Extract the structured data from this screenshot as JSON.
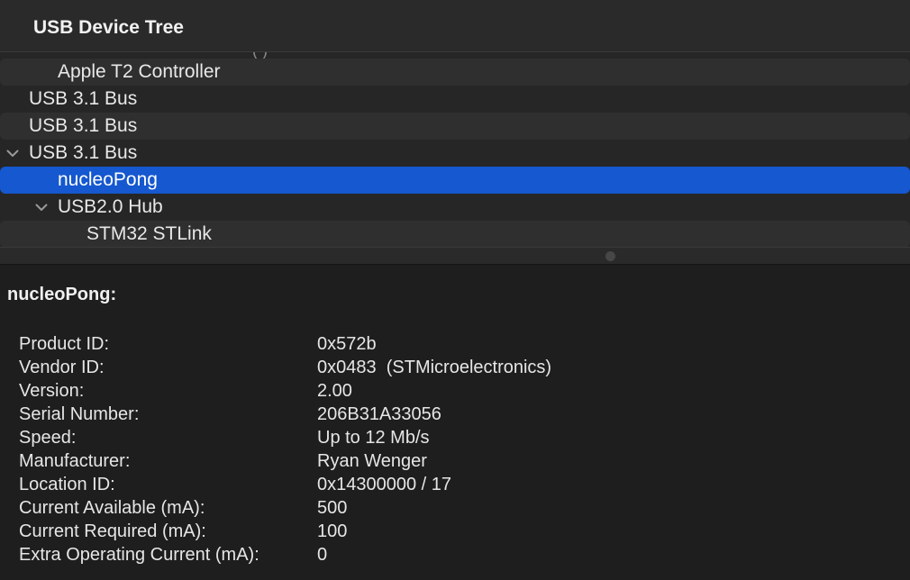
{
  "tree": {
    "header_title": "USB Device Tree",
    "cut_text": "( )",
    "rows": [
      {
        "label": "Apple T2 Controller",
        "level": 2,
        "expanded": null,
        "selected": false
      },
      {
        "label": "USB 3.1 Bus",
        "level": 1,
        "expanded": false,
        "selected": false
      },
      {
        "label": "USB 3.1 Bus",
        "level": 1,
        "expanded": false,
        "selected": false
      },
      {
        "label": "USB 3.1 Bus",
        "level": 1,
        "expanded": true,
        "selected": false
      },
      {
        "label": "nucleoPong",
        "level": 2,
        "expanded": null,
        "selected": true
      },
      {
        "label": "USB2.0 Hub",
        "level": 2,
        "expanded": true,
        "selected": false
      },
      {
        "label": "STM32 STLink",
        "level": 3,
        "expanded": null,
        "selected": false
      }
    ]
  },
  "detail": {
    "title": "nucleoPong:",
    "properties": [
      {
        "key": "Product ID:",
        "value": "0x572b"
      },
      {
        "key": "Vendor ID:",
        "value": "0x0483  (STMicroelectronics)"
      },
      {
        "key": "Version:",
        "value": "2.00"
      },
      {
        "key": "Serial Number:",
        "value": "206B31A33056"
      },
      {
        "key": "Speed:",
        "value": "Up to 12 Mb/s"
      },
      {
        "key": "Manufacturer:",
        "value": "Ryan Wenger"
      },
      {
        "key": "Location ID:",
        "value": "0x14300000 / 17"
      },
      {
        "key": "Current Available (mA):",
        "value": "500"
      },
      {
        "key": "Current Required (mA):",
        "value": "100"
      },
      {
        "key": "Extra Operating Current (mA):",
        "value": "0"
      }
    ]
  },
  "colors": {
    "selection": "#1558cf",
    "background": "#1e1e1e",
    "tree_background": "#262626",
    "row_stripe": "#2f2f2f"
  },
  "icons": {
    "expanded": "chevron-down-icon",
    "collapsed": "chevron-right-icon"
  }
}
